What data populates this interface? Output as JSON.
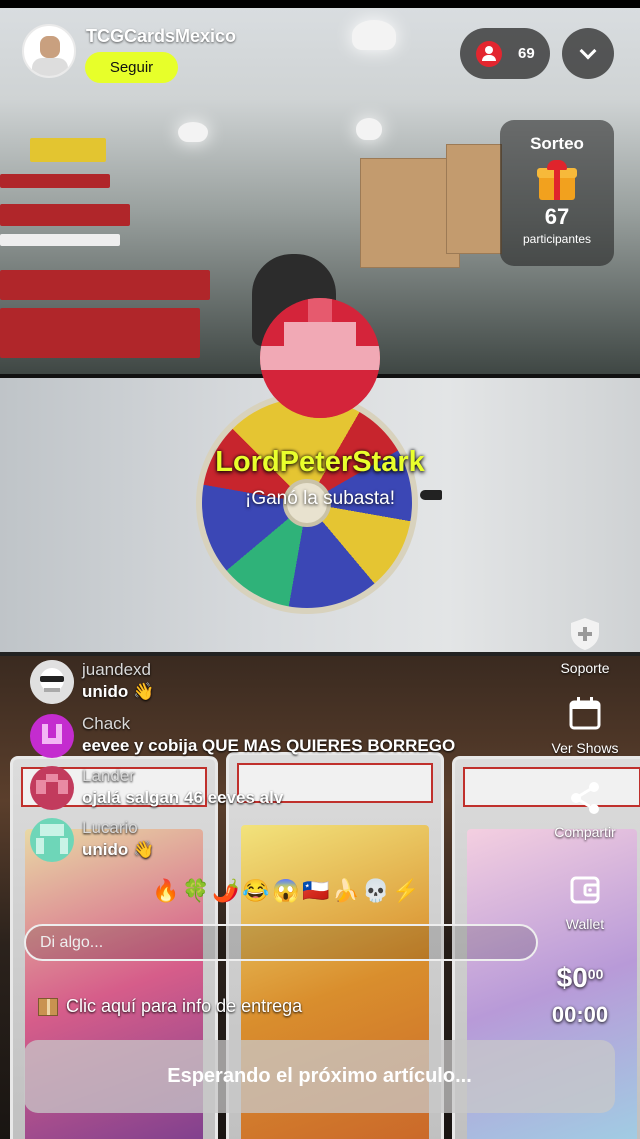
{
  "header": {
    "channel_name": "TCGCardsMexico",
    "follow_label": "Seguir"
  },
  "viewers": {
    "count": "69"
  },
  "raffle": {
    "title": "Sorteo",
    "count": "67",
    "label": "participantes"
  },
  "winner": {
    "name": "LordPeterStark",
    "message": "¡Ganó la subasta!"
  },
  "side_actions": [
    {
      "label": "Soporte",
      "icon": "support-shield-icon"
    },
    {
      "label": "Ver Shows",
      "icon": "calendar-icon"
    },
    {
      "label": "Compartir",
      "icon": "share-icon"
    },
    {
      "label": "Wallet",
      "icon": "wallet-icon"
    }
  ],
  "chat": [
    {
      "user": "juandexd",
      "message": "unido 👋",
      "avatar_color": "#555555"
    },
    {
      "user": "Chack",
      "message": "eevee y cobija QUE MAS QUIERES BORREGO",
      "avatar_color": "#c42ccf"
    },
    {
      "user": "Lander",
      "message": "ojalá salgan 46 eeves alv",
      "avatar_color": "#c23b5d"
    },
    {
      "user": "Lucario",
      "message": "unido 👋",
      "avatar_color": "#6ed6b8"
    }
  ],
  "reactions": [
    "🔥",
    "🍀",
    "🌶️",
    "😂",
    "😱",
    "🇨🇱",
    "🍌",
    "💀",
    "⚡"
  ],
  "input": {
    "placeholder": "Di algo..."
  },
  "delivery": {
    "label": "Clic aquí para info de entrega"
  },
  "auction": {
    "price_main": "$0",
    "price_cents": "00",
    "timer": "00:00",
    "status_button": "Esperando el próximo artículo..."
  },
  "colors": {
    "follow_button": "#e7ff2a",
    "winner_name": "#e9ff2c",
    "viewer_icon": "#e3262f"
  }
}
